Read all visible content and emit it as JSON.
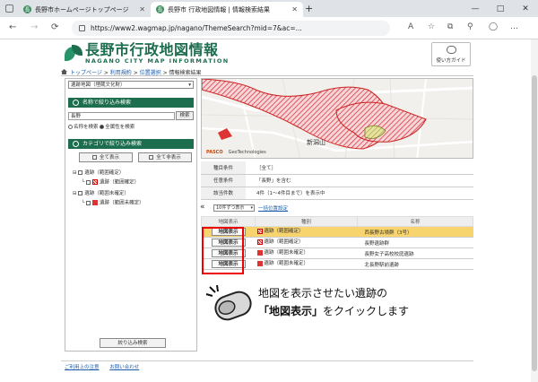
{
  "browser": {
    "tabs": [
      {
        "title": "長野市ホームページトップページ",
        "icon": "city-favicon"
      },
      {
        "title": "長野市 行政地図情報 | 情報検索結果",
        "icon": "map-favicon"
      }
    ],
    "new_tab": "+",
    "url": "https://www2.wagmap.jp/nagano/ThemeSearch?mid=7&ac=...",
    "window_controls": [
      "—",
      "□",
      "✕"
    ],
    "nav": {
      "back": "←",
      "forward": "→",
      "reload": "⟳"
    }
  },
  "site": {
    "title_jp": "長野市行政地図情報",
    "title_en": "NAGANO CITY MAP INFORMATION",
    "guide_label": "使い方ガイド"
  },
  "breadcrumb": {
    "items": [
      "トップページ",
      "利用規約",
      "位置選択"
    ],
    "current": "情報検索結果",
    "sep": ">"
  },
  "left_panel": {
    "dataset_select": "遺跡地図（埋蔵文化財）",
    "name_search": {
      "title": "名称で絞り込み検索",
      "value": "長野",
      "button": "検索",
      "options": [
        "名称を検索",
        "全属性を検索"
      ],
      "selected": 1
    },
    "category": {
      "title": "カテゴリで絞り込み検索",
      "show_all": "全て表示",
      "hide_all": "全て非表示",
      "groups": [
        {
          "label": "遺跡（範囲確定）",
          "child": "遺跡（範囲確定）",
          "swatch": "hatch"
        },
        {
          "label": "遺跡（範囲未確定）",
          "child": "遺跡（範囲未確定）",
          "swatch": "solid"
        }
      ]
    },
    "apply_button": "絞り込み検索"
  },
  "map": {
    "label": "新潟山",
    "attribution": [
      "PASCO",
      "GeoTechnologies"
    ]
  },
  "conditions": [
    {
      "key": "種目条件",
      "value": "［全て］"
    },
    {
      "key": "任意条件",
      "value": "「長野」を含む"
    },
    {
      "key": "該当件数",
      "value": "4件（1〜4件目まで）を表示中"
    }
  ],
  "results": {
    "collapse_icon": "«",
    "per_page": "10件ずつ表示",
    "select_all_link": "一括位置設定",
    "columns": [
      "地図表示",
      "種別",
      "名称"
    ],
    "button_label": "地図表示",
    "rows": [
      {
        "type": "遺跡（範囲確定）",
        "name": "西長野古墳群（3号）",
        "swatch": "hatch",
        "selected": true
      },
      {
        "type": "遺跡（範囲確定）",
        "name": "長野遺跡群",
        "swatch": "hatch",
        "selected": false
      },
      {
        "type": "遺跡（範囲未確定）",
        "name": "長野女子高校校庭遺跡",
        "swatch": "solid",
        "selected": false
      },
      {
        "type": "遺跡（範囲未確定）",
        "name": "北長野駅前遺跡",
        "swatch": "solid",
        "selected": false
      }
    ]
  },
  "annotation": {
    "line1": "地図を表示させたい遺跡の",
    "line2_em": "「地図表示」",
    "line2_rest": "をクイックします"
  },
  "footer": {
    "links": [
      "ご利用上の注意",
      "お問い合わせ"
    ]
  },
  "colors": {
    "brand_green": "#1d6e4f",
    "highlight_row": "#f8d46e",
    "emphasis_red": "#e00000"
  }
}
